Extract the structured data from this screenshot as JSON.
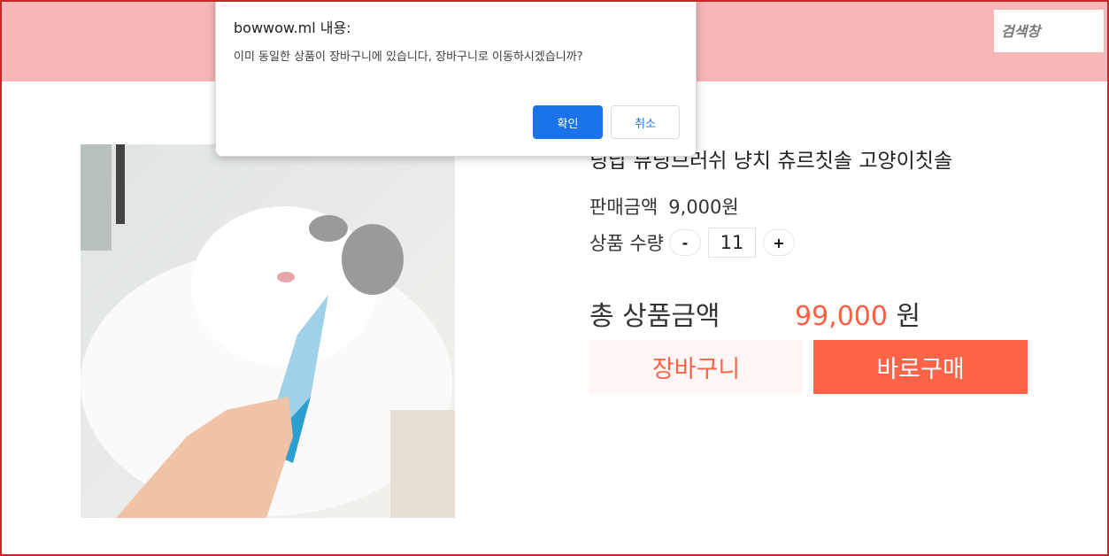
{
  "header": {
    "search_placeholder": "검색창"
  },
  "product": {
    "title": "닝납 뷰닝브러쉬 냥치 츄르칫솔 고양이칫솔",
    "price_label": "판매금액",
    "price_value": "9,000원",
    "quantity_label": "상품 수량",
    "quantity_minus": "-",
    "quantity_value": "11",
    "quantity_plus": "+",
    "total_label": "총 상품금액",
    "total_amount": "99,000",
    "total_unit": "원",
    "cart_button": "장바구니",
    "buy_button": "바로구매"
  },
  "dialog": {
    "title": "bowwow.ml 내용:",
    "message": "이미 동일한 상품이 장바구니에 있습니다, 장바구니로 이동하시겠습니까?",
    "ok_label": "확인",
    "cancel_label": "취소"
  },
  "colors": {
    "header_bg": "#f7b6b7",
    "accent": "#ff6449",
    "dialog_primary": "#1a73e8",
    "frame_border": "#c62828"
  }
}
